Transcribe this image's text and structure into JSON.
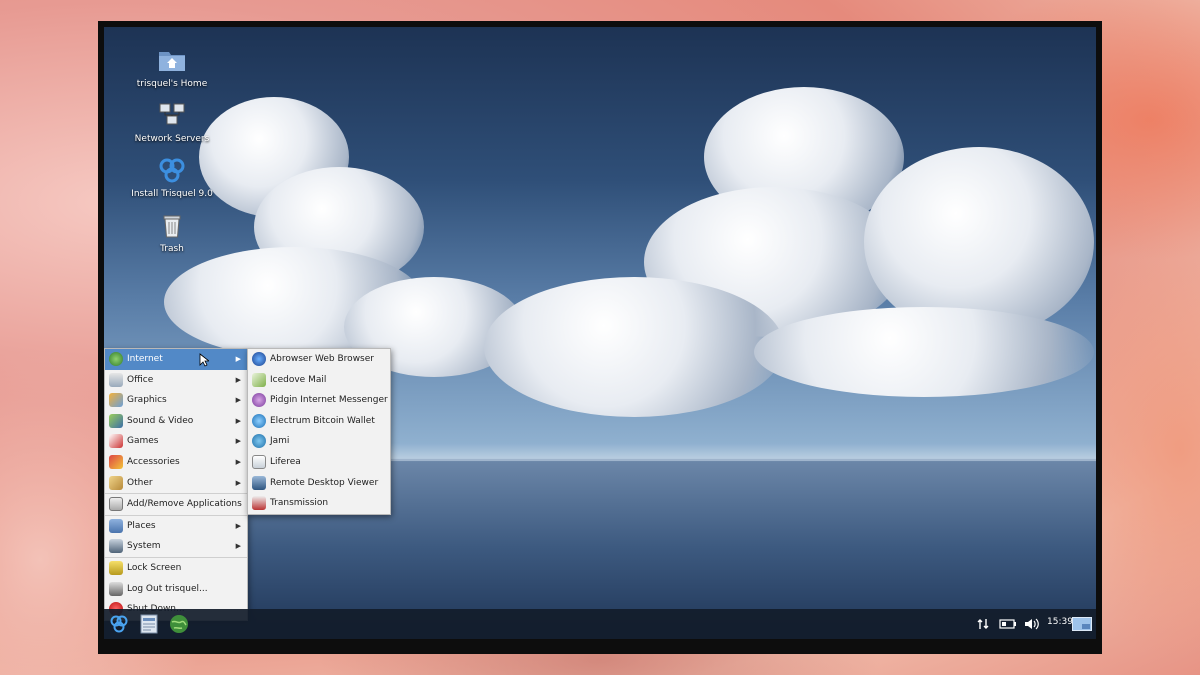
{
  "desktop": {
    "icons": [
      {
        "label": "trisquel's Home",
        "icon": "folder-home-icon"
      },
      {
        "label": "Network Servers",
        "icon": "network-servers-icon"
      },
      {
        "label": "Install Trisquel 9.0",
        "icon": "trisquel-logo-icon"
      },
      {
        "label": "Trash",
        "icon": "trash-icon"
      }
    ]
  },
  "main_menu": {
    "items": [
      {
        "label": "Internet",
        "icon": "globe-icon",
        "submenu": true,
        "active": true
      },
      {
        "label": "Office",
        "icon": "office-icon",
        "submenu": true
      },
      {
        "label": "Graphics",
        "icon": "graphics-icon",
        "submenu": true
      },
      {
        "label": "Sound & Video",
        "icon": "sound-video-icon",
        "submenu": true
      },
      {
        "label": "Games",
        "icon": "games-icon",
        "submenu": true
      },
      {
        "label": "Accessories",
        "icon": "accessories-icon",
        "submenu": true
      },
      {
        "label": "Other",
        "icon": "other-icon",
        "submenu": true
      },
      {
        "label": "Add/Remove Applications",
        "icon": "package-icon",
        "submenu": false
      },
      {
        "label": "Places",
        "icon": "folder-icon",
        "submenu": true
      },
      {
        "label": "System",
        "icon": "system-icon",
        "submenu": true
      },
      {
        "label": "Lock Screen",
        "icon": "lock-icon",
        "submenu": false
      },
      {
        "label": "Log Out trisquel...",
        "icon": "logout-icon",
        "submenu": false
      },
      {
        "label": "Shut Down...",
        "icon": "power-icon",
        "submenu": false
      }
    ]
  },
  "internet_submenu": {
    "items": [
      {
        "label": "Abrowser Web Browser",
        "icon": "abrowser-icon"
      },
      {
        "label": "Icedove Mail",
        "icon": "icedove-icon"
      },
      {
        "label": "Pidgin Internet Messenger",
        "icon": "pidgin-icon"
      },
      {
        "label": "Electrum Bitcoin Wallet",
        "icon": "electrum-icon"
      },
      {
        "label": "Jami",
        "icon": "jami-icon"
      },
      {
        "label": "Liferea",
        "icon": "liferea-icon"
      },
      {
        "label": "Remote Desktop Viewer",
        "icon": "remote-desktop-icon"
      },
      {
        "label": "Transmission",
        "icon": "transmission-icon"
      }
    ]
  },
  "taskbar": {
    "launchers": [
      "trisquel-menu-icon",
      "file-manager-icon",
      "web-browser-icon"
    ],
    "tray": {
      "network": "network-arrows-icon",
      "battery": "battery-icon",
      "volume": "volume-icon",
      "clock": "15:39",
      "workspace": "workspace-switcher-icon"
    }
  },
  "colors": {
    "menu_highlight": "#5289c7",
    "taskbar": "#121c2a"
  }
}
